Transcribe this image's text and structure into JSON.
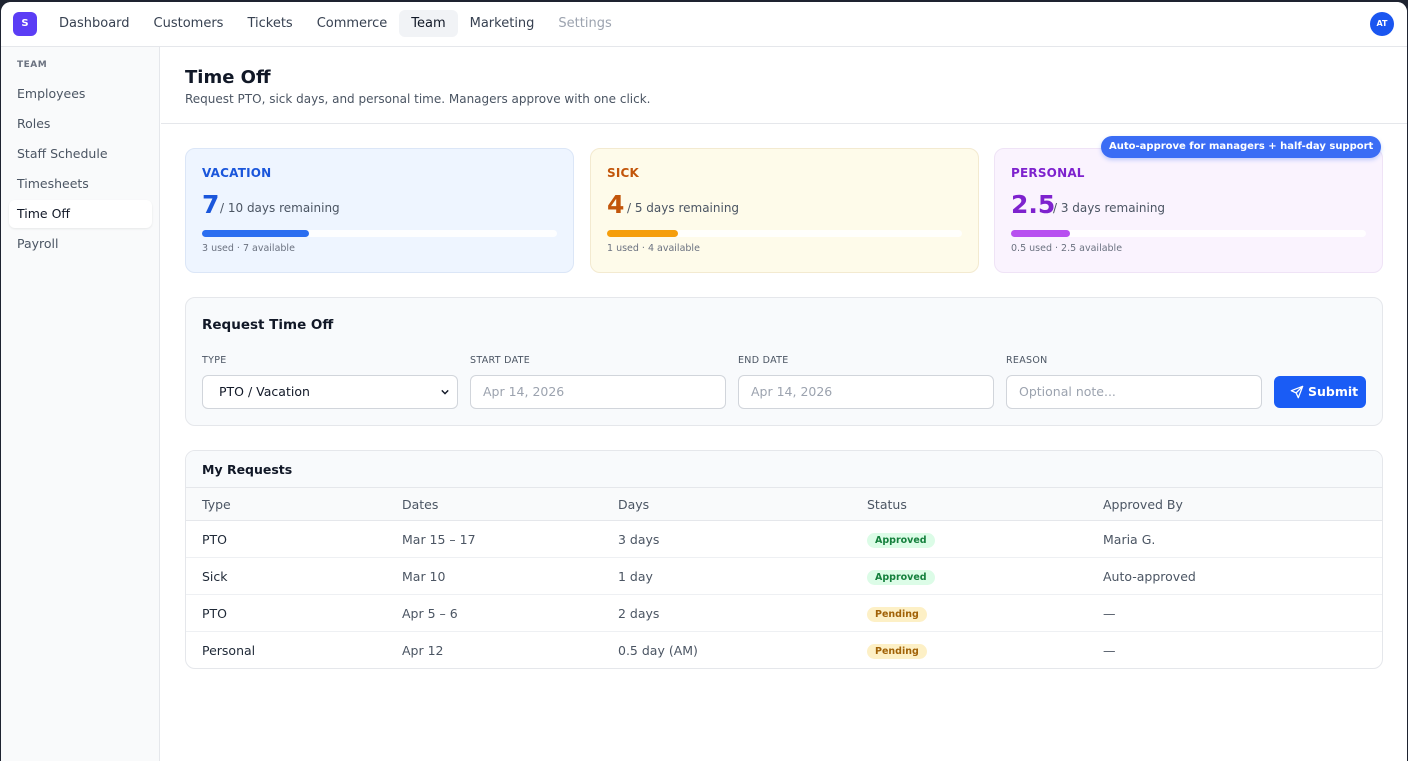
{
  "app": {
    "logo_letter": "S",
    "avatar_initials": "AT"
  },
  "nav": {
    "items": [
      {
        "label": "Dashboard"
      },
      {
        "label": "Customers"
      },
      {
        "label": "Tickets"
      },
      {
        "label": "Commerce"
      },
      {
        "label": "Team",
        "active": true
      },
      {
        "label": "Marketing"
      },
      {
        "label": "Settings",
        "muted": true
      }
    ]
  },
  "sidebar": {
    "section": "TEAM",
    "items": [
      {
        "label": "Employees"
      },
      {
        "label": "Roles"
      },
      {
        "label": "Staff Schedule"
      },
      {
        "label": "Timesheets"
      },
      {
        "label": "Time Off",
        "active": true
      },
      {
        "label": "Payroll"
      }
    ]
  },
  "page": {
    "title": "Time Off",
    "subtitle": "Request PTO, sick days, and personal time. Managers approve with one click."
  },
  "balances": {
    "pill": "Auto-approve for managers + half-day support",
    "vacation": {
      "label": "VACATION",
      "remaining": "7",
      "total_text": "/ 10 days remaining",
      "meta": "3 used · 7 available",
      "used_fraction": 0.3,
      "color": "#1a56db",
      "bar": "#2b6ef0"
    },
    "sick": {
      "label": "SICK",
      "remaining": "4",
      "total_text": "/ 5 days remaining",
      "meta": "1 used · 4 available",
      "used_fraction": 0.2,
      "color": "#c2550a",
      "bar": "#f59e0b"
    },
    "personal": {
      "label": "PERSONAL",
      "remaining": "2.5",
      "total_text": "/ 3 days remaining",
      "meta": "0.5 used · 2.5 available",
      "used_fraction": 0.1667,
      "color": "#7e22ce",
      "bar": "#b84ff0"
    }
  },
  "form": {
    "title": "Request Time Off",
    "type_label": "TYPE",
    "type_value": "PTO / Vacation",
    "start_label": "START DATE",
    "start_placeholder": "Apr 14, 2026",
    "end_label": "END DATE",
    "end_placeholder": "Apr 14, 2026",
    "reason_label": "REASON",
    "reason_placeholder": "Optional note...",
    "submit_label": "Submit"
  },
  "requests": {
    "title": "My Requests",
    "columns": [
      "Type",
      "Dates",
      "Days",
      "Status",
      "Approved By"
    ],
    "rows": [
      {
        "type": "PTO",
        "dates": "Mar 15 – 17",
        "days": "3 days",
        "status": "Approved",
        "approved_by": "Maria G."
      },
      {
        "type": "Sick",
        "dates": "Mar 10",
        "days": "1 day",
        "status": "Approved",
        "approved_by": "Auto-approved"
      },
      {
        "type": "PTO",
        "dates": "Apr 5 – 6",
        "days": "2 days",
        "status": "Pending",
        "approved_by": "—"
      },
      {
        "type": "Personal",
        "dates": "Apr 12",
        "days": "0.5 day (AM)",
        "status": "Pending",
        "approved_by": "—"
      }
    ]
  }
}
